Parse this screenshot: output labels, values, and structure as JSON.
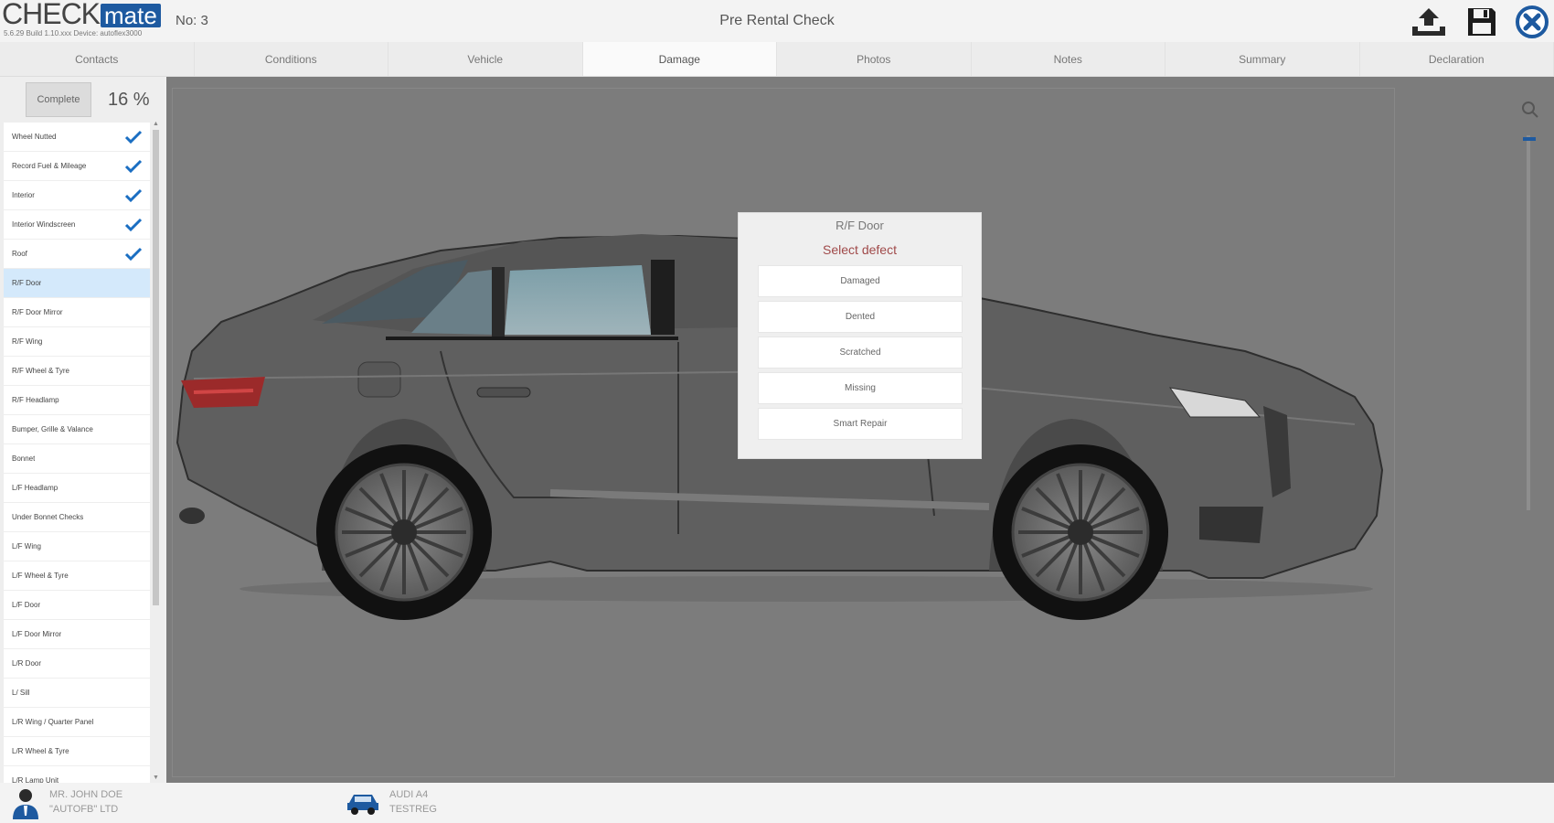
{
  "header": {
    "logo_check": "CHECK",
    "logo_mate": "mate",
    "version": "5.6.29 Build 1.10.xxx   Device: autoflex3000",
    "job_number": "No: 3",
    "title": "Pre Rental Check",
    "icons": [
      "upload-icon",
      "save-icon",
      "close-icon"
    ]
  },
  "tabs": [
    {
      "label": "Contacts",
      "active": false
    },
    {
      "label": "Conditions",
      "active": false
    },
    {
      "label": "Vehicle",
      "active": false
    },
    {
      "label": "Damage",
      "active": true
    },
    {
      "label": "Photos",
      "active": false
    },
    {
      "label": "Notes",
      "active": false
    },
    {
      "label": "Summary",
      "active": false
    },
    {
      "label": "Declaration",
      "active": false
    }
  ],
  "sidebar": {
    "complete_label": "Complete",
    "progress": "16 %",
    "items": [
      {
        "label": "Wheel Nutted",
        "done": true
      },
      {
        "label": "Record Fuel & Mileage",
        "done": true
      },
      {
        "label": "Interior",
        "done": true
      },
      {
        "label": "Interior Windscreen",
        "done": true
      },
      {
        "label": "Roof",
        "done": true
      },
      {
        "label": "R/F Door",
        "done": false,
        "selected": true
      },
      {
        "label": "R/F Door Mirror",
        "done": false
      },
      {
        "label": "R/F Wing",
        "done": false
      },
      {
        "label": "R/F Wheel & Tyre",
        "done": false
      },
      {
        "label": "R/F Headlamp",
        "done": false
      },
      {
        "label": "Bumper, Grille & Valance",
        "done": false
      },
      {
        "label": "Bonnet",
        "done": false
      },
      {
        "label": "L/F Headlamp",
        "done": false
      },
      {
        "label": "Under Bonnet Checks",
        "done": false
      },
      {
        "label": "L/F Wing",
        "done": false
      },
      {
        "label": "L/F Wheel & Tyre",
        "done": false
      },
      {
        "label": "L/F Door",
        "done": false
      },
      {
        "label": "L/F Door Mirror",
        "done": false
      },
      {
        "label": "L/R Door",
        "done": false
      },
      {
        "label": "L/ Sill",
        "done": false
      },
      {
        "label": "L/R Wing / Quarter Panel",
        "done": false
      },
      {
        "label": "L/R Wheel & Tyre",
        "done": false
      },
      {
        "label": "L/R Lamp Unit",
        "done": false
      }
    ]
  },
  "popup": {
    "title": "R/F Door",
    "subtitle": "Select defect",
    "options": [
      "Damaged",
      "Dented",
      "Scratched",
      "Missing",
      "Smart Repair"
    ]
  },
  "footer": {
    "customer_name": "MR. JOHN DOE",
    "customer_company": "\"AUTOFB\" LTD",
    "vehicle_model": "AUDI A4",
    "vehicle_reg": "TESTREG"
  },
  "colors": {
    "accent": "#1e5aa0",
    "check": "#1a6ec2",
    "selected_row": "#d4e9fb",
    "canvas": "#7c7c7c",
    "defect_prompt": "#a04a4a"
  }
}
